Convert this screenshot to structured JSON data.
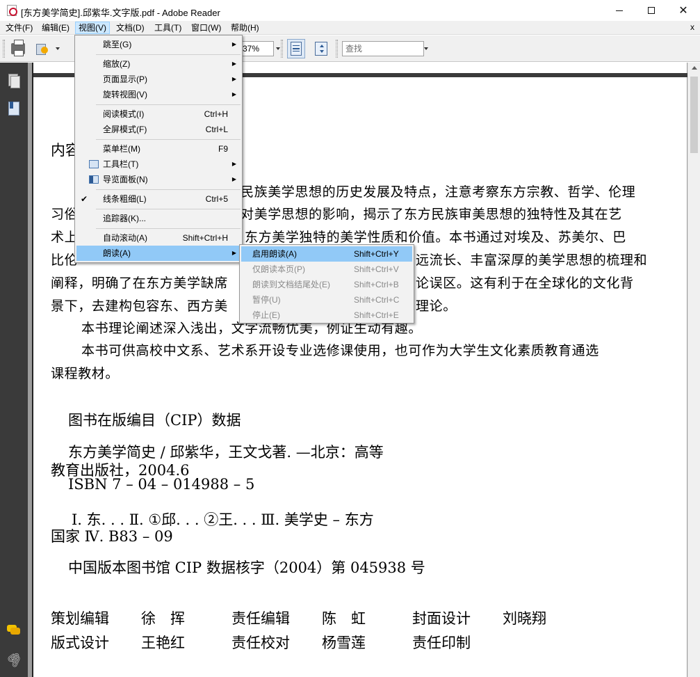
{
  "window": {
    "title": "[东方美学简史].邱紫华.文字版.pdf - Adobe Reader",
    "icon": "pdf-file-icon"
  },
  "menubar": {
    "items": [
      "文件(F)",
      "编辑(E)",
      "视图(V)",
      "文档(D)",
      "工具(T)",
      "窗口(W)",
      "帮助(H)"
    ],
    "active": "视图(V)",
    "close_glyph": "x"
  },
  "toolbar": {
    "zoom_value": "37%",
    "search_placeholder": "查找"
  },
  "view_menu": {
    "items": [
      {
        "label": "跳至(G)",
        "shortcut": "",
        "submenu": true
      },
      {
        "label": "缩放(Z)",
        "shortcut": "",
        "submenu": true
      },
      {
        "label": "页面显示(P)",
        "shortcut": "",
        "submenu": true
      },
      {
        "label": "旋转视图(V)",
        "shortcut": "",
        "submenu": true
      },
      {
        "label": "阅读模式(I)",
        "shortcut": "Ctrl+H",
        "submenu": false
      },
      {
        "label": "全屏模式(F)",
        "shortcut": "Ctrl+L",
        "submenu": false
      },
      {
        "label": "菜单栏(M)",
        "shortcut": "F9",
        "submenu": false
      },
      {
        "label": "工具栏(T)",
        "shortcut": "",
        "submenu": true
      },
      {
        "label": "导览面板(N)",
        "shortcut": "",
        "submenu": true
      },
      {
        "label": "线条粗细(L)",
        "shortcut": "Ctrl+5",
        "submenu": false,
        "checked": true
      },
      {
        "label": "追踪器(K)...",
        "shortcut": "",
        "submenu": false
      },
      {
        "label": "自动滚动(A)",
        "shortcut": "Shift+Ctrl+H",
        "submenu": false
      },
      {
        "label": "朗读(A)",
        "shortcut": "",
        "submenu": true,
        "highlighted": true
      }
    ]
  },
  "read_aloud_menu": {
    "items": [
      {
        "label": "启用朗读(A)",
        "shortcut": "Shift+Ctrl+Y",
        "enabled": true
      },
      {
        "label": "仅朗读本页(P)",
        "shortcut": "Shift+Ctrl+V",
        "enabled": false
      },
      {
        "label": "朗读到文档结尾处(E)",
        "shortcut": "Shift+Ctrl+B",
        "enabled": false
      },
      {
        "label": "暂停(U)",
        "shortcut": "Shift+Ctrl+C",
        "enabled": false
      },
      {
        "label": "停止(E)",
        "shortcut": "Shift+Ctrl+E",
        "enabled": false
      }
    ]
  },
  "document": {
    "heading_fragment": "内容",
    "line1": "民族美学思想的历史发展及特点，注意考察东方宗教、哲学、伦理",
    "line2_prefix": "习俗",
    "line2": "对美学思想的影响，揭示了东方民族审美思想的独特性及其在艺",
    "line3_prefix": "术上",
    "line3": "东方美学独特的美学性质和价值。本书通过对埃及、苏美尔、巴",
    "line4_prefix": "比伦",
    "line4": "远流长、丰富深厚的美学思想的梳理和",
    "line5_prefix": "阐释，明确了在东方美学缺席",
    "line5": "论误区。这有利于在全球化的文化背",
    "line6_prefix": "景下，去建构包容东、西方美",
    "line6": "理论。",
    "line7": "本书理论阐述深入浅出，文字流畅优美，例证生动有趣。",
    "line8": "本书可供高校中文系、艺术系开设专业选修课使用，也可作为大学生文化素质教育通选",
    "line9": "课程教材。",
    "cip_title": "图书在版编目（CIP）数据",
    "cip_line1": "东方美学简史 / 邱紫华，王文戈著. —北京：高等",
    "cip_line2": "教育出版社，2004.6",
    "cip_isbn": "ISBN 7 – 04 – 014988 – 5",
    "cip_class1": "Ⅰ. 东. . .    Ⅱ. ①邱. . . ②王. . .    Ⅲ. 美学史 – 东方",
    "cip_class2": "国家   Ⅳ. B83 – 09",
    "cip_number": "中国版本图书馆 CIP 数据核字（2004）第 045938 号",
    "credits": {
      "planner_label": "策划编辑",
      "planner": "徐　挥",
      "editor_label": "责任编辑",
      "editor": "陈　虹",
      "cover_label": "封面设计",
      "cover": "刘晓翔",
      "layout_label": "版式设计",
      "layout": "王艳红",
      "proof_label": "责任校对",
      "proof": "杨雪莲",
      "print_label": "责任印制"
    }
  },
  "colors": {
    "menu_highlight": "#91c9f7",
    "menubar_active": "#cce8ff",
    "nav_panel": "#3a3a3a"
  }
}
